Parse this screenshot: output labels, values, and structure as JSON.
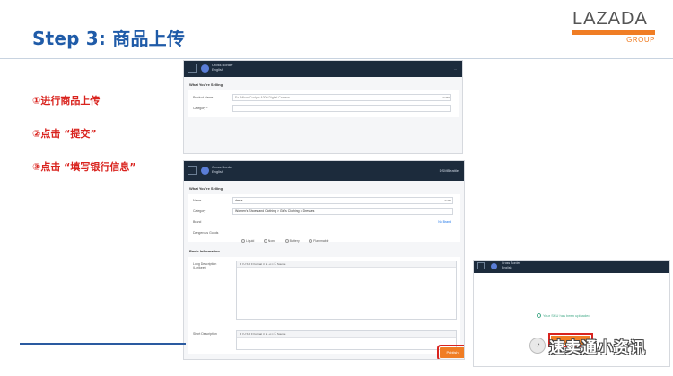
{
  "slide": {
    "title": "Step 3: 商品上传",
    "steps": [
      "①进行商品上传",
      "②点击 “提交”",
      "③点击 “填写银行信息”"
    ]
  },
  "logo": {
    "name": "LAZADA",
    "sub": "GROUP",
    "accent": "#f07d24"
  },
  "colors": {
    "title": "#1f5ba8",
    "step": "#d9231e",
    "topbar": "#1c2b3c"
  },
  "screen1": {
    "header": {
      "line1": "Cross Border",
      "line2": "English",
      "user": "..."
    },
    "section": "What You're Selling",
    "fields": [
      {
        "label": "Product Name",
        "placeholder": "Ex. Nikon Coolpix A300 Digital Camera",
        "count": "0/255"
      },
      {
        "label": "Category *",
        "placeholder": ""
      }
    ]
  },
  "screen2": {
    "header": {
      "line1": "Cross Border",
      "line2": "English",
      "user": "DSMBeattle"
    },
    "section": "What You're Selling",
    "name": {
      "label": "Name",
      "value": "dress",
      "count": "6/255"
    },
    "category": {
      "label": "Category",
      "value": "Women's Shoes and Clothing > Girl's Clothing > Dresses"
    },
    "brand": {
      "label": "Brand",
      "link": "No Brand"
    },
    "dangerous": {
      "label": "Dangerous Goods",
      "options": [
        "Liquid",
        "None",
        "Battery",
        "Flammable"
      ]
    },
    "basic_section": "Basic Information",
    "long_desc_label": "Long Description (Lorikeet)",
    "short_desc_label": "Short Description",
    "toolbar": "B I U S ≡ ≡ Format ∨ ⇤ ⇥ ∞ ⇱ Source",
    "publish_label": "Publish"
  },
  "screen3": {
    "header": {
      "line1": "Cross Border",
      "line2": "English"
    },
    "success": "Your SKU has been uploaded"
  },
  "watermark": {
    "text": "速卖通小资讯",
    "icon": "wechat-icon"
  }
}
